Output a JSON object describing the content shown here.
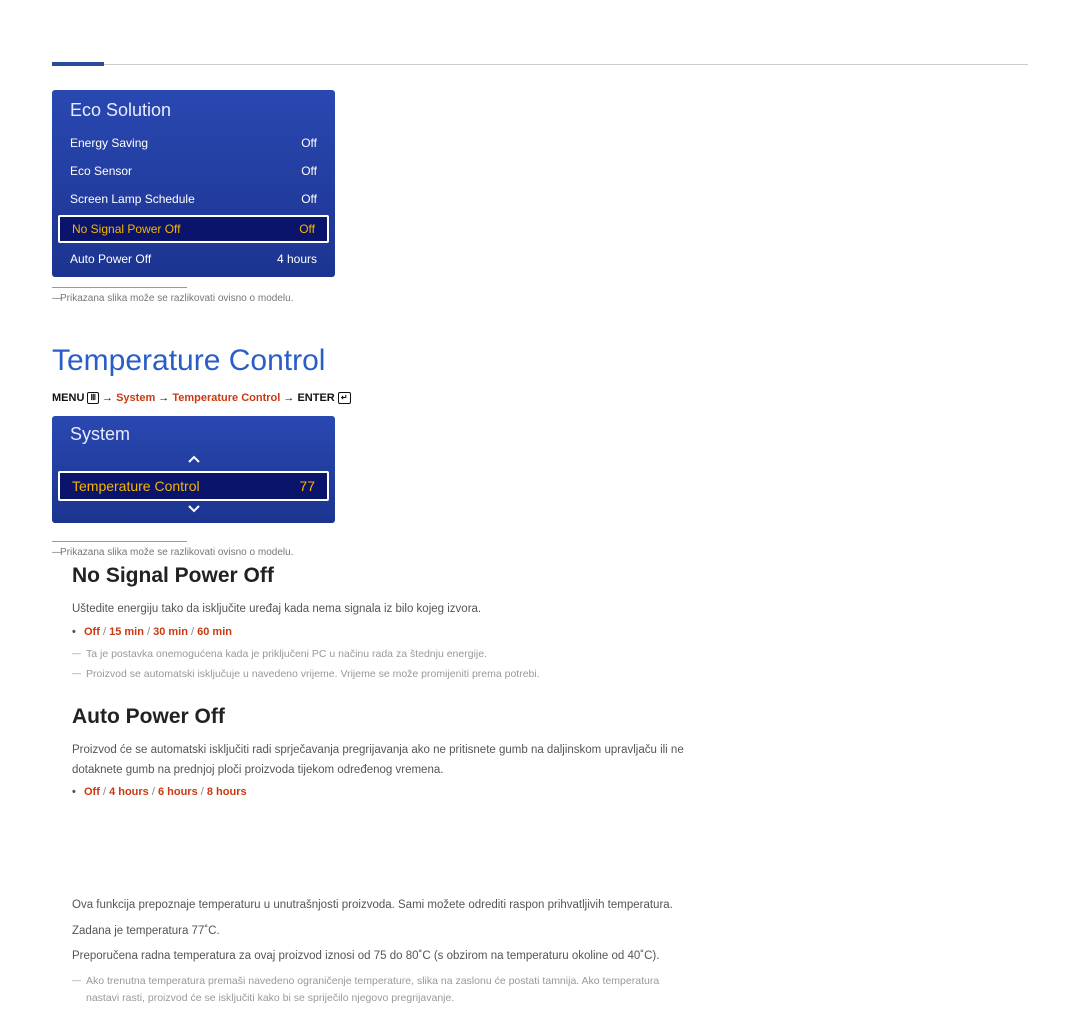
{
  "eco_panel": {
    "title": "Eco Solution",
    "rows": [
      {
        "label": "Energy Saving",
        "value": "Off"
      },
      {
        "label": "Eco Sensor",
        "value": "Off"
      },
      {
        "label": "Screen Lamp Schedule",
        "value": "Off"
      },
      {
        "label": "No Signal Power Off",
        "value": "Off",
        "selected": true
      },
      {
        "label": "Auto Power Off",
        "value": "4 hours"
      }
    ]
  },
  "note_text": "Prikazana slika može se razlikovati ovisno o modelu.",
  "temperature_heading": "Temperature Control",
  "breadcrumb": {
    "menu": "MENU",
    "system": "System",
    "tc": "Temperature Control",
    "enter": "ENTER"
  },
  "system_panel": {
    "title": "System",
    "item_label": "Temperature Control",
    "item_value": "77"
  },
  "right": {
    "h_no_signal": "No Signal Power Off",
    "p_no_signal": "Uštedite energiju tako da isključite uređaj kada nema signala iz bilo kojeg izvora.",
    "opt_no_signal": "Off / 15 min / 30 min / 60 min",
    "sub1": "Ta je postavka onemogućena kada je priključeni PC u načinu rada za štednju energije.",
    "sub2": "Proizvod se automatski isključuje u navedeno vrijeme. Vrijeme se može promijeniti prema potrebi.",
    "h_auto": "Auto Power Off",
    "p_auto": "Proizvod će se automatski isključiti radi sprječavanja pregrijavanja ako ne pritisnete gumb na daljinskom upravljaču ili ne dotaknete gumb na prednjoj ploči proizvoda tijekom određenog vremena.",
    "opt_auto": "Off / 4 hours / 6 hours / 8 hours",
    "tc_p1": "Ova funkcija prepoznaje temperaturu u unutrašnjosti proizvoda. Sami možete odrediti raspon prihvatljivih temperatura.",
    "tc_p2": "Zadana je temperatura 77˚C.",
    "tc_p3": "Preporučena radna temperatura za ovaj proizvod iznosi od 75 do 80˚C (s obzirom na temperaturu okoline od 40˚C).",
    "tc_sub": "Ako trenutna temperatura premaši navedeno ograničenje temperature, slika na zaslonu će postati tamnija. Ako temperatura nastavi rasti, proizvod će se isključiti kako bi se spriječilo njegovo pregrijavanje."
  }
}
